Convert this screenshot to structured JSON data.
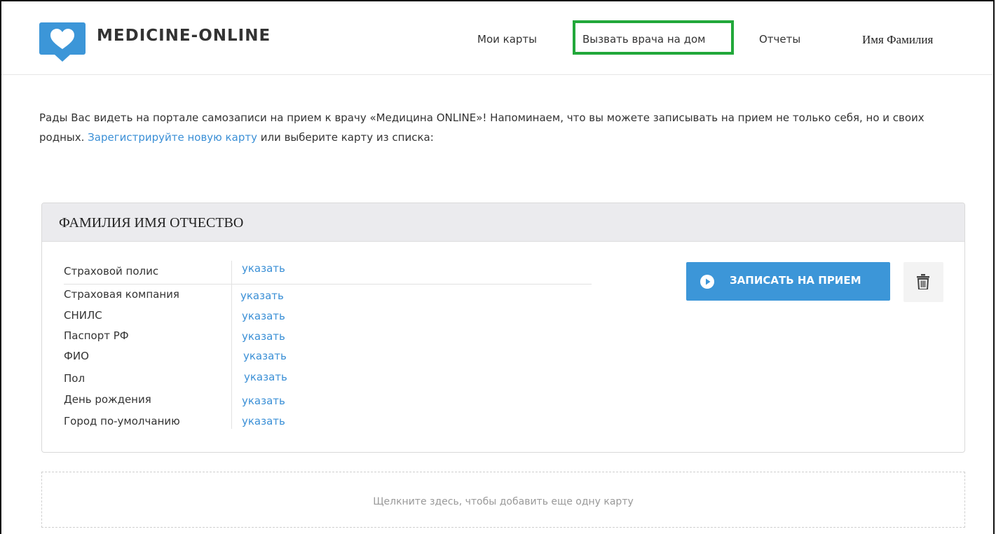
{
  "header": {
    "logo_text": "MEDICINE-ONLINE",
    "nav": [
      {
        "label": "Мои карты"
      },
      {
        "label": "Вызвать врача на дом"
      },
      {
        "label": "Отчеты"
      }
    ],
    "user_name": "Имя Фамилия"
  },
  "intro": {
    "text_before": "Рады Вас видеть на портале самозаписи на прием к врачу «Медицина ONLINE»! Напоминаем, что вы можете записывать на прием не только себя, но и своих родных. ",
    "link": "Зарегистрируйте новую карту",
    "text_after": " или выберите карту из списка:"
  },
  "card": {
    "title": "ФАМИЛИЯ ИМЯ ОТЧЕСТВО",
    "fields": [
      {
        "label": "Страховой полис",
        "value": "указать"
      },
      {
        "label": "Страховая компания",
        "value": "указать"
      },
      {
        "label": "СНИЛС",
        "value": "указать"
      },
      {
        "label": "Паспорт РФ",
        "value": "указать"
      },
      {
        "label": "ФИО",
        "value": "указать"
      },
      {
        "label": "Пол",
        "value": "указать"
      },
      {
        "label": "День рождения",
        "value": "указать"
      },
      {
        "label": "Город по-умолчанию",
        "value": "указать"
      }
    ],
    "book_button": "ЗАПИСАТЬ НА ПРИЕМ"
  },
  "add_card": "Щелкните здесь, чтобы добавить еще одну карту",
  "colors": {
    "accent": "#3c96d8",
    "link": "#3a8fd6",
    "highlight": "#22a83a"
  }
}
